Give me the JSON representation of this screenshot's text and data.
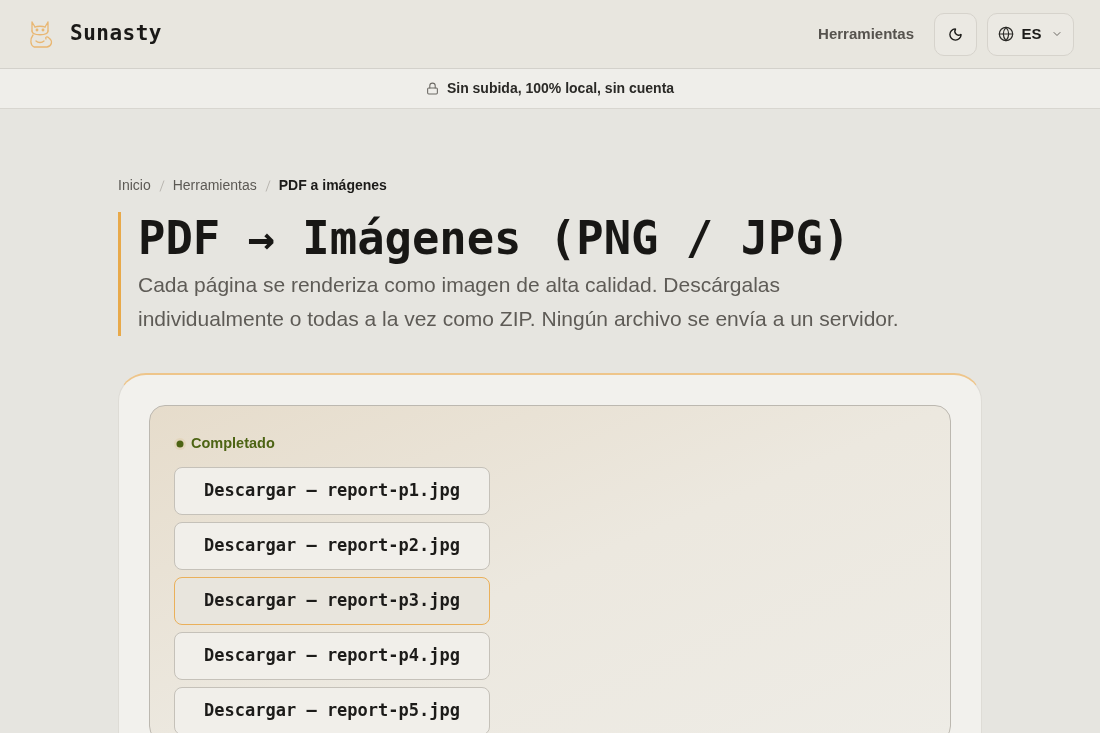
{
  "header": {
    "brand": "Sunasty",
    "nav": [
      {
        "label": "Herramientas"
      }
    ],
    "language": "ES"
  },
  "banner": {
    "text": "Sin subida, 100% local, sin cuenta"
  },
  "breadcrumb": [
    {
      "label": "Inicio",
      "current": false
    },
    {
      "label": "Herramientas",
      "current": false
    },
    {
      "label": "PDF a imágenes",
      "current": true
    }
  ],
  "page": {
    "title": "PDF → Imágenes (PNG / JPG)",
    "description": "Cada página se renderiza como imagen de alta calidad. Descárgalas individualmente o todas a la vez como ZIP. Ningún archivo se envía a un servidor."
  },
  "result": {
    "status": {
      "label": "Completado",
      "color": "#4d6414"
    },
    "downloads": [
      {
        "label": "Descargar — report-p1.jpg",
        "selected": false
      },
      {
        "label": "Descargar — report-p2.jpg",
        "selected": false
      },
      {
        "label": "Descargar — report-p3.jpg",
        "selected": true
      },
      {
        "label": "Descargar — report-p4.jpg",
        "selected": false
      },
      {
        "label": "Descargar — report-p5.jpg",
        "selected": false
      }
    ]
  }
}
